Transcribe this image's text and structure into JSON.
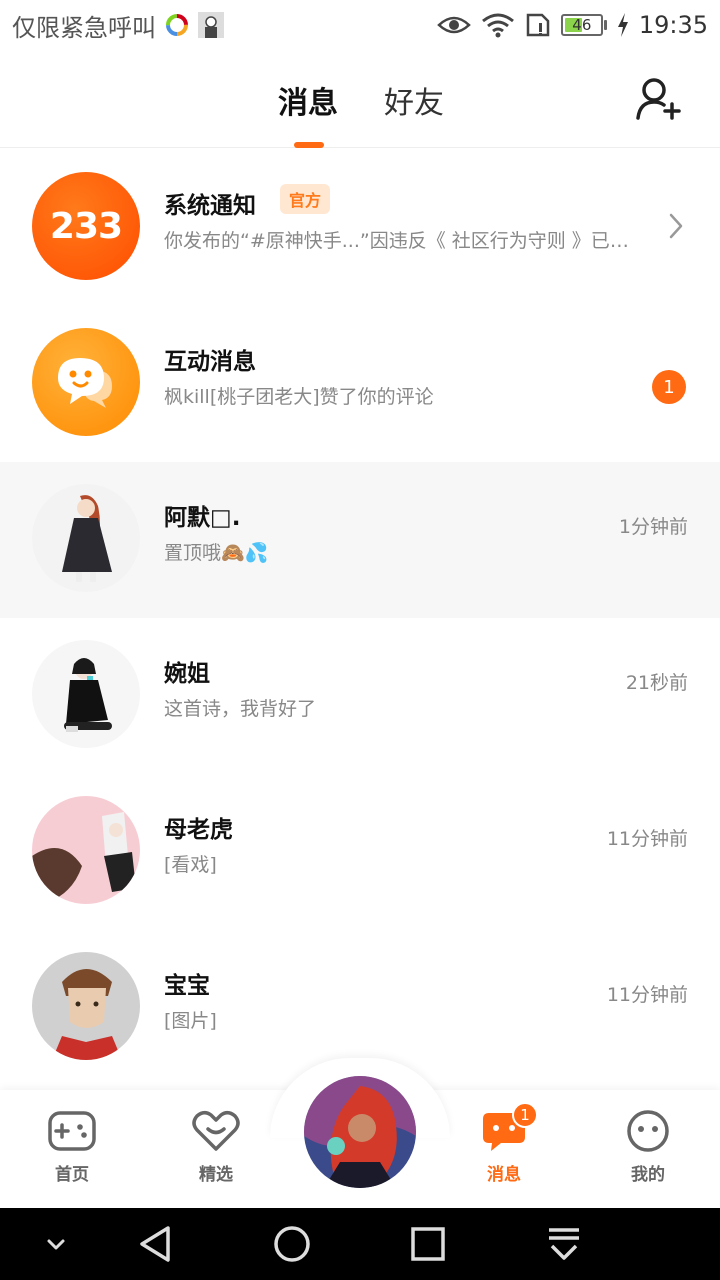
{
  "status_bar": {
    "left_text": "仅限紧急呼叫",
    "battery_level": "46",
    "time": "19:35"
  },
  "header": {
    "tabs": [
      {
        "label": "消息",
        "active": true
      },
      {
        "label": "好友",
        "active": false
      }
    ],
    "add_friend_icon": "add-user-icon"
  },
  "messages": [
    {
      "name": "系统通知",
      "badge": "官方",
      "preview": "你发布的“#原神快手...”因违反《 社区行为守则 》已被...",
      "avatar_text": "233"
    },
    {
      "name": "互动消息",
      "preview": "枫kill[桃子团老大]赞了你的评论",
      "unread": "1"
    },
    {
      "name": "阿默□.",
      "preview": "置顶哦🙈💦",
      "time": "1分钟前"
    },
    {
      "name": "婉姐",
      "preview": "这首诗，我背好了",
      "time": "21秒前"
    },
    {
      "name": "母老虎",
      "preview": "[看戏]",
      "time": "11分钟前"
    },
    {
      "name": "宝宝",
      "preview": "[图片]",
      "time": "11分钟前"
    }
  ],
  "bottom_nav": {
    "items": [
      {
        "label": "首页",
        "icon": "gamepad-icon"
      },
      {
        "label": "精选",
        "icon": "heart-chat-icon"
      },
      {
        "label": "消息",
        "icon": "message-icon",
        "badge": "1",
        "active": true
      },
      {
        "label": "我的",
        "icon": "smiley-icon"
      }
    ]
  },
  "colors": {
    "accent": "#ff6a13",
    "official_badge_bg": "#ffe7d2",
    "highlight_row": "#f7f7f7"
  }
}
